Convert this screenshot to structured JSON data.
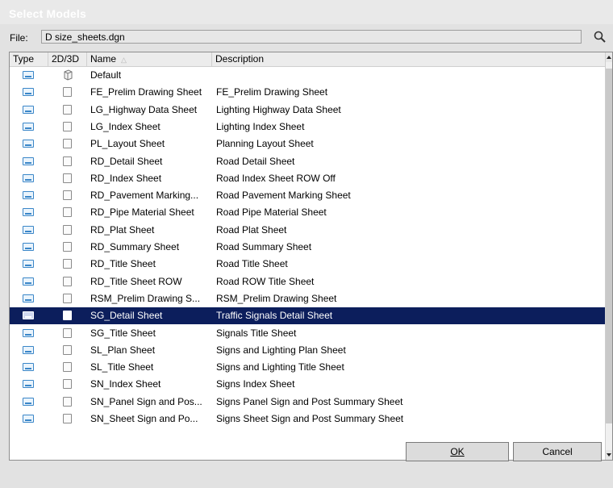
{
  "window": {
    "title": "Select Models"
  },
  "file": {
    "label": "File:",
    "value": "D size_sheets.dgn"
  },
  "columns": [
    {
      "label": "Type"
    },
    {
      "label": "2D/3D"
    },
    {
      "label": "Name",
      "sort": "△"
    },
    {
      "label": "Description"
    }
  ],
  "rows": [
    {
      "name": "Default",
      "description": "",
      "dim_icon": "cube-icon",
      "selected": false
    },
    {
      "name": "FE_Prelim Drawing Sheet",
      "description": "FE_Prelim Drawing Sheet",
      "dim_icon": "box-icon",
      "selected": false
    },
    {
      "name": "LG_Highway Data Sheet",
      "description": "Lighting Highway Data Sheet",
      "dim_icon": "box-icon",
      "selected": false
    },
    {
      "name": "LG_Index Sheet",
      "description": "Lighting Index Sheet",
      "dim_icon": "box-icon",
      "selected": false
    },
    {
      "name": "PL_Layout Sheet",
      "description": "Planning Layout Sheet",
      "dim_icon": "box-icon",
      "selected": false
    },
    {
      "name": "RD_Detail Sheet",
      "description": "Road Detail Sheet",
      "dim_icon": "box-icon",
      "selected": false
    },
    {
      "name": "RD_Index Sheet",
      "description": "Road Index Sheet ROW Off",
      "dim_icon": "box-icon",
      "selected": false
    },
    {
      "name": "RD_Pavement Marking...",
      "description": "Road Pavement Marking Sheet",
      "dim_icon": "box-icon",
      "selected": false
    },
    {
      "name": "RD_Pipe Material Sheet",
      "description": "Road Pipe Material Sheet",
      "dim_icon": "box-icon",
      "selected": false
    },
    {
      "name": "RD_Plat Sheet",
      "description": "Road Plat Sheet",
      "dim_icon": "box-icon",
      "selected": false
    },
    {
      "name": "RD_Summary Sheet",
      "description": "Road Summary Sheet",
      "dim_icon": "box-icon",
      "selected": false
    },
    {
      "name": "RD_Title Sheet",
      "description": "Road Title Sheet",
      "dim_icon": "box-icon",
      "selected": false
    },
    {
      "name": "RD_Title Sheet ROW",
      "description": "Road ROW Title Sheet",
      "dim_icon": "box-icon",
      "selected": false
    },
    {
      "name": "RSM_Prelim Drawing S...",
      "description": "RSM_Prelim Drawing Sheet",
      "dim_icon": "box-icon",
      "selected": false
    },
    {
      "name": "SG_Detail Sheet",
      "description": "Traffic Signals Detail Sheet",
      "dim_icon": "box-icon",
      "selected": true
    },
    {
      "name": "SG_Title Sheet",
      "description": "Signals Title Sheet",
      "dim_icon": "box-icon",
      "selected": false
    },
    {
      "name": "SL_Plan Sheet",
      "description": "Signs and Lighting Plan Sheet",
      "dim_icon": "box-icon",
      "selected": false
    },
    {
      "name": "SL_Title Sheet",
      "description": "Signs and Lighting Title Sheet",
      "dim_icon": "box-icon",
      "selected": false
    },
    {
      "name": "SN_Index Sheet",
      "description": "Signs Index Sheet",
      "dim_icon": "box-icon",
      "selected": false
    },
    {
      "name": "SN_Panel Sign and Pos...",
      "description": "Signs Panel Sign and Post Summary Sheet",
      "dim_icon": "box-icon",
      "selected": false
    },
    {
      "name": "SN_Sheet Sign and Po...",
      "description": "Signs Sheet Sign and Post Summary Sheet",
      "dim_icon": "box-icon",
      "selected": false
    }
  ],
  "buttons": {
    "ok": "OK",
    "cancel": "Cancel"
  },
  "colors": {
    "selection": "#0c1e5c",
    "dialog_bg": "#e2e2e2",
    "icon_accent": "#3a86c8"
  },
  "icons": {
    "search": "magnifier-icon",
    "type": "model-sheet-icon"
  }
}
